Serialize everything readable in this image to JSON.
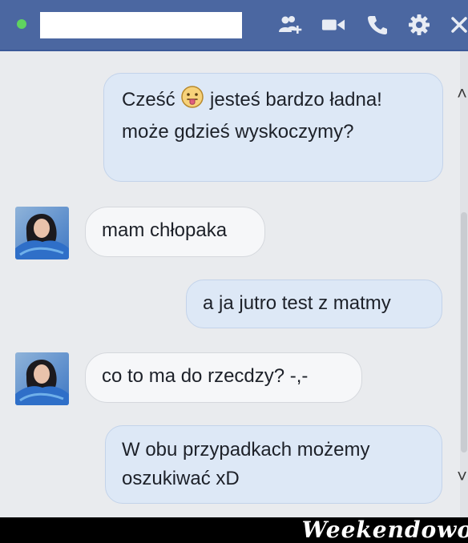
{
  "header": {
    "contact_name": "",
    "icons": [
      "add-friend-icon",
      "video-call-icon",
      "phone-icon",
      "gear-icon",
      "close-icon"
    ],
    "online_color": "#5fd35f",
    "bar_color": "#4b67a1"
  },
  "messages": [
    {
      "from": "me",
      "text_before_emoji": "Cześć",
      "emoji": "tongue-out-face-icon",
      "text_after_emoji": "jesteś bardzo ładna! może gdzieś wyskoczymy?"
    },
    {
      "from": "contact",
      "text": "mam chłopaka"
    },
    {
      "from": "me",
      "text": "a ja jutro test z matmy"
    },
    {
      "from": "contact",
      "text": "co to ma do rzecdzy? -,-"
    },
    {
      "from": "me",
      "text": "W obu przypadkach możemy oszukiwać xD"
    }
  ],
  "footer": {
    "watermark": "Weekendowo"
  },
  "colors": {
    "outgoing_bubble": "#dde8f6",
    "incoming_bubble": "#f6f7f9",
    "chat_background": "#e9ebee"
  }
}
